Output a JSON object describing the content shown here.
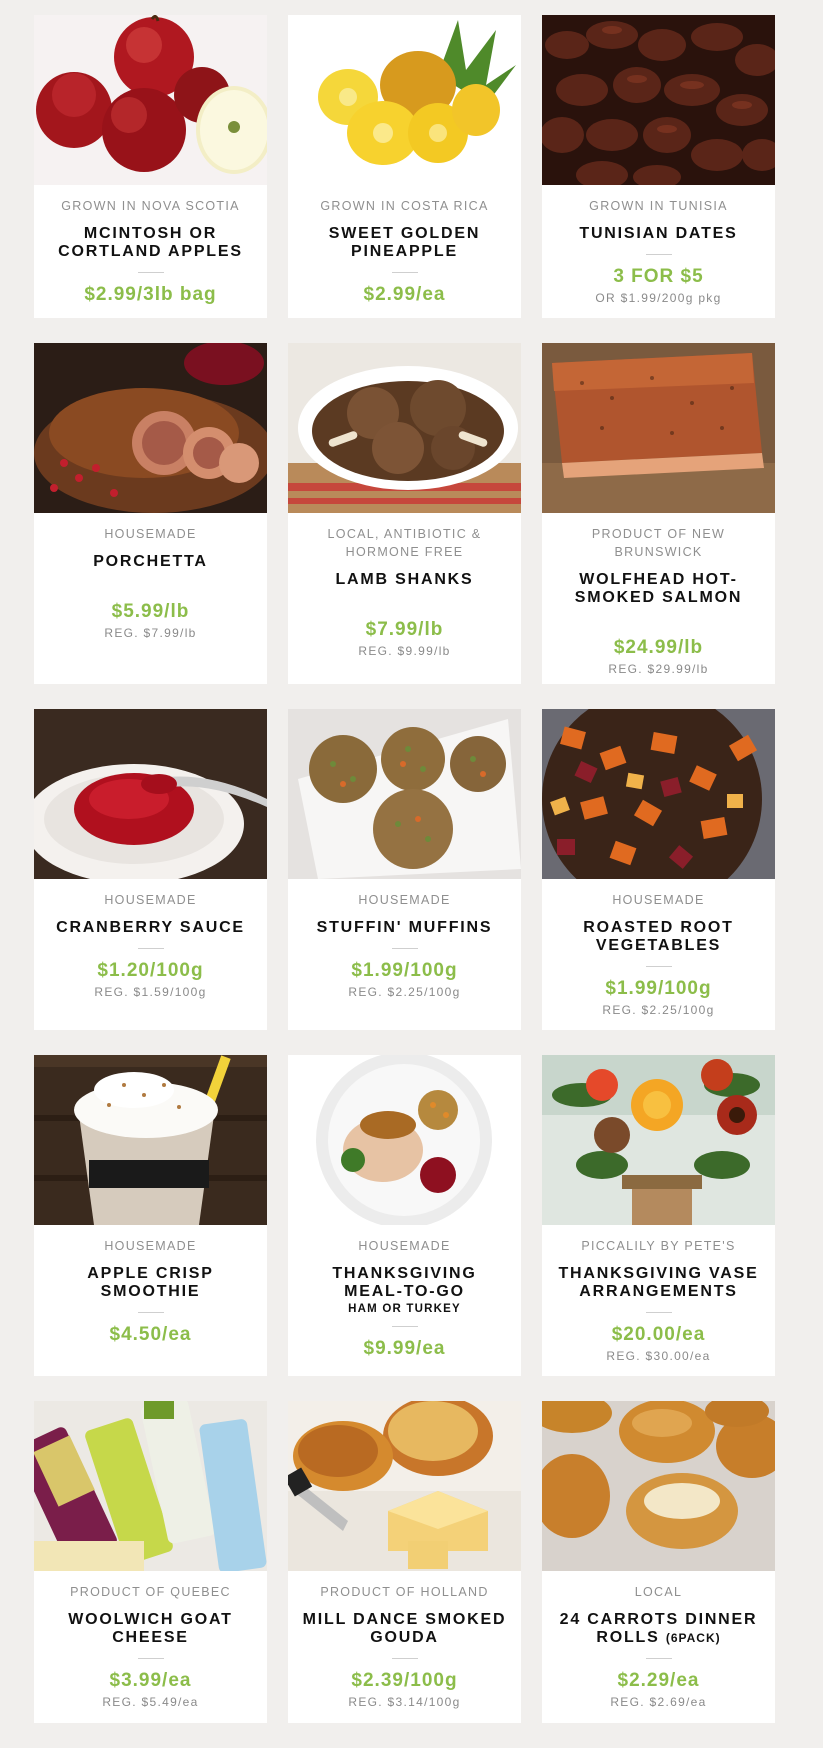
{
  "products": [
    {
      "origin": "GROWN IN NOVA SCOTIA",
      "name": "MCINTOSH OR CORTLAND APPLES",
      "price": "$2.99/3lb bag",
      "reg": "",
      "image": "apples-image"
    },
    {
      "origin": "GROWN IN COSTA RICA",
      "name": "SWEET GOLDEN PINEAPPLE",
      "price": "$2.99/ea",
      "reg": "",
      "image": "pineapple-image"
    },
    {
      "origin": "GROWN IN TUNISIA",
      "name": "TUNISIAN DATES",
      "price": "3 FOR $5",
      "reg": "OR $1.99/200g pkg",
      "image": "dates-image"
    },
    {
      "origin": "HOUSEMADE",
      "name": "PORCHETTA",
      "price": "$5.99/lb",
      "reg": "REG. $7.99/lb",
      "image": "porchetta-image"
    },
    {
      "origin": "LOCAL, ANTIBIOTIC & HORMONE FREE",
      "name": "LAMB SHANKS",
      "price": "$7.99/lb",
      "reg": "REG. $9.99/lb",
      "image": "lamb-shanks-image"
    },
    {
      "origin": "PRODUCT OF NEW BRUNSWICK",
      "name": "WOLFHEAD HOT-SMOKED SALMON",
      "price": "$24.99/lb",
      "reg": "REG. $29.99/lb",
      "image": "salmon-image"
    },
    {
      "origin": "HOUSEMADE",
      "name": "CRANBERRY SAUCE",
      "price": "$1.20/100g",
      "reg": "REG. $1.59/100g",
      "image": "cranberry-sauce-image"
    },
    {
      "origin": "HOUSEMADE",
      "name": "STUFFIN' MUFFINS",
      "price": "$1.99/100g",
      "reg": "REG. $2.25/100g",
      "image": "stuffin-muffins-image"
    },
    {
      "origin": "HOUSEMADE",
      "name": "ROASTED ROOT VEGETABLES",
      "price": "$1.99/100g",
      "reg": "REG. $2.25/100g",
      "image": "root-vegetables-image"
    },
    {
      "origin": "HOUSEMADE",
      "name": "APPLE CRISP SMOOTHIE",
      "price": "$4.50/ea",
      "reg": "",
      "image": "smoothie-image"
    },
    {
      "origin": "HOUSEMADE",
      "name": "THANKSGIVING MEAL-TO-GO",
      "sub": "HAM OR TURKEY",
      "price": "$9.99/ea",
      "reg": "",
      "image": "meal-image"
    },
    {
      "origin": "PICCALILY BY PETE'S",
      "name": "THANKSGIVING VASE ARRANGEMENTS",
      "price": "$20.00/ea",
      "reg": "REG. $30.00/ea",
      "image": "flowers-image"
    },
    {
      "origin": "PRODUCT OF QUEBEC",
      "name": "WOOLWICH GOAT CHEESE",
      "price": "$3.99/ea",
      "reg": "REG. $5.49/ea",
      "image": "goat-cheese-image"
    },
    {
      "origin": "PRODUCT OF HOLLAND",
      "name": "MILL DANCE SMOKED GOUDA",
      "price": "$2.39/100g",
      "reg": "REG. $3.14/100g",
      "image": "gouda-image"
    },
    {
      "origin": "LOCAL",
      "name": "24 CARROTS DINNER ROLLS",
      "name_suffix": "(6PACK)",
      "price": "$2.29/ea",
      "reg": "REG. $2.69/ea",
      "image": "dinner-rolls-image"
    }
  ],
  "colors": {
    "background": "#f1efed",
    "card": "#ffffff",
    "price": "#8cbd4a",
    "origin": "#8f8f8f",
    "name": "#111111"
  }
}
